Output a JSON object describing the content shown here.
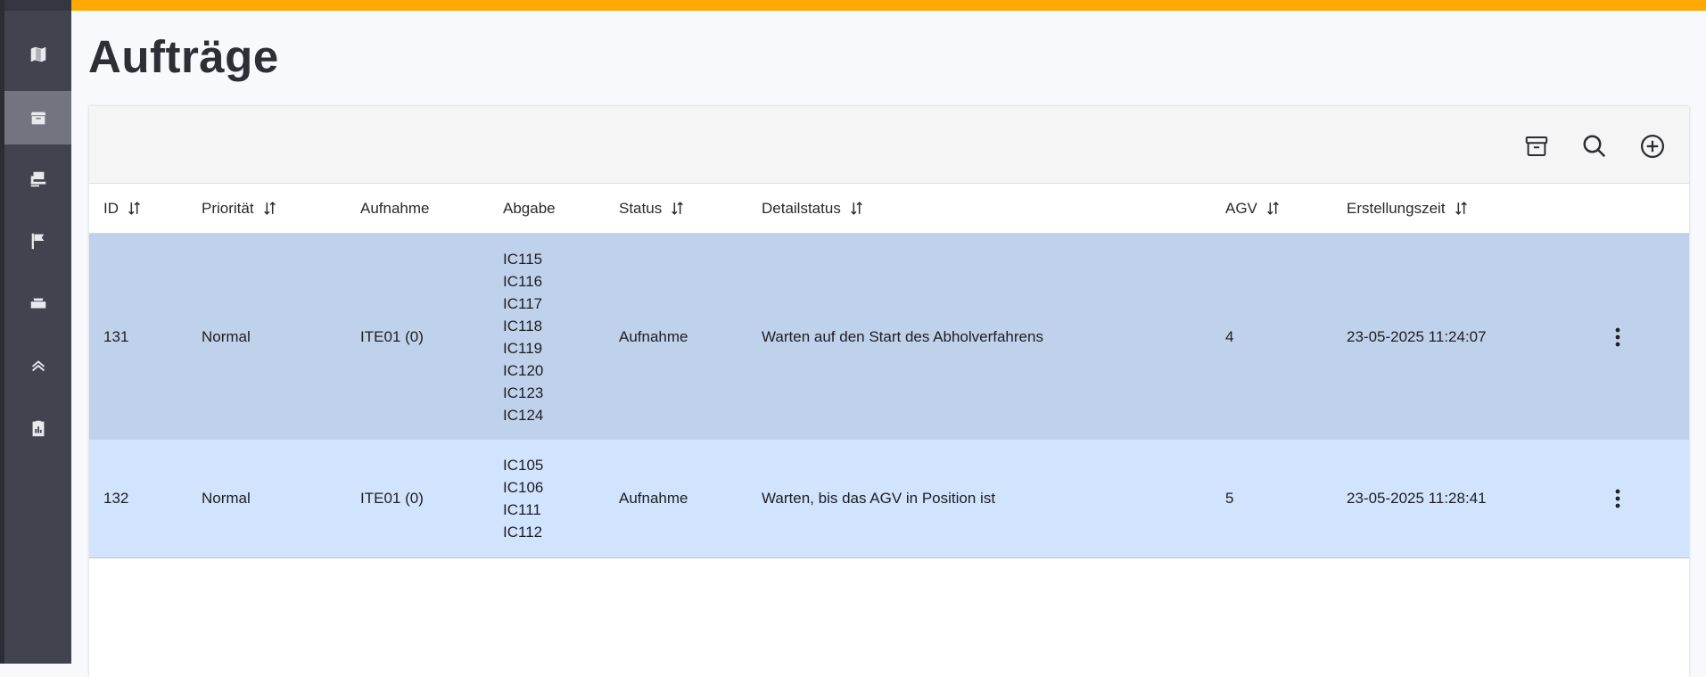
{
  "page": {
    "title": "Aufträge"
  },
  "colors": {
    "accent": "#ffa800",
    "sidebar": "#41444f",
    "row_selected": "#c0d1ec",
    "row_highlight": "#d1e3fd"
  },
  "sidebar": {
    "items": [
      {
        "icon": "map-icon",
        "active": false
      },
      {
        "icon": "box-icon",
        "active": true
      },
      {
        "icon": "forklift-icon",
        "active": false
      },
      {
        "icon": "flag-icon",
        "active": false
      },
      {
        "icon": "tray-icon",
        "active": false
      },
      {
        "icon": "double-chevron-up-icon",
        "active": false
      },
      {
        "icon": "clipboard-chart-icon",
        "active": false
      }
    ]
  },
  "toolbar": {
    "icons": [
      "archive-icon",
      "search-icon",
      "add-circle-icon"
    ]
  },
  "table": {
    "columns": [
      {
        "label": "ID",
        "sortable": true
      },
      {
        "label": "Priorität",
        "sortable": true
      },
      {
        "label": "Aufnahme",
        "sortable": false
      },
      {
        "label": "Abgabe",
        "sortable": false
      },
      {
        "label": "Status",
        "sortable": true
      },
      {
        "label": "Detailstatus",
        "sortable": true
      },
      {
        "label": "AGV",
        "sortable": true
      },
      {
        "label": "Erstellungszeit",
        "sortable": true
      }
    ],
    "rows": [
      {
        "id": "131",
        "priority": "Normal",
        "pickup": "ITE01 (0)",
        "dropoff": [
          "IC115",
          "IC116",
          "IC117",
          "IC118",
          "IC119",
          "IC120",
          "IC123",
          "IC124"
        ],
        "status": "Aufnahme",
        "detail": "Warten auf den Start des Abholverfahrens",
        "agv": "4",
        "created": "23-05-2025 11:24:07"
      },
      {
        "id": "132",
        "priority": "Normal",
        "pickup": "ITE01 (0)",
        "dropoff": [
          "IC105",
          "IC106",
          "IC111",
          "IC112"
        ],
        "status": "Aufnahme",
        "detail": "Warten, bis das AGV in Position ist",
        "agv": "5",
        "created": "23-05-2025 11:28:41"
      }
    ]
  }
}
